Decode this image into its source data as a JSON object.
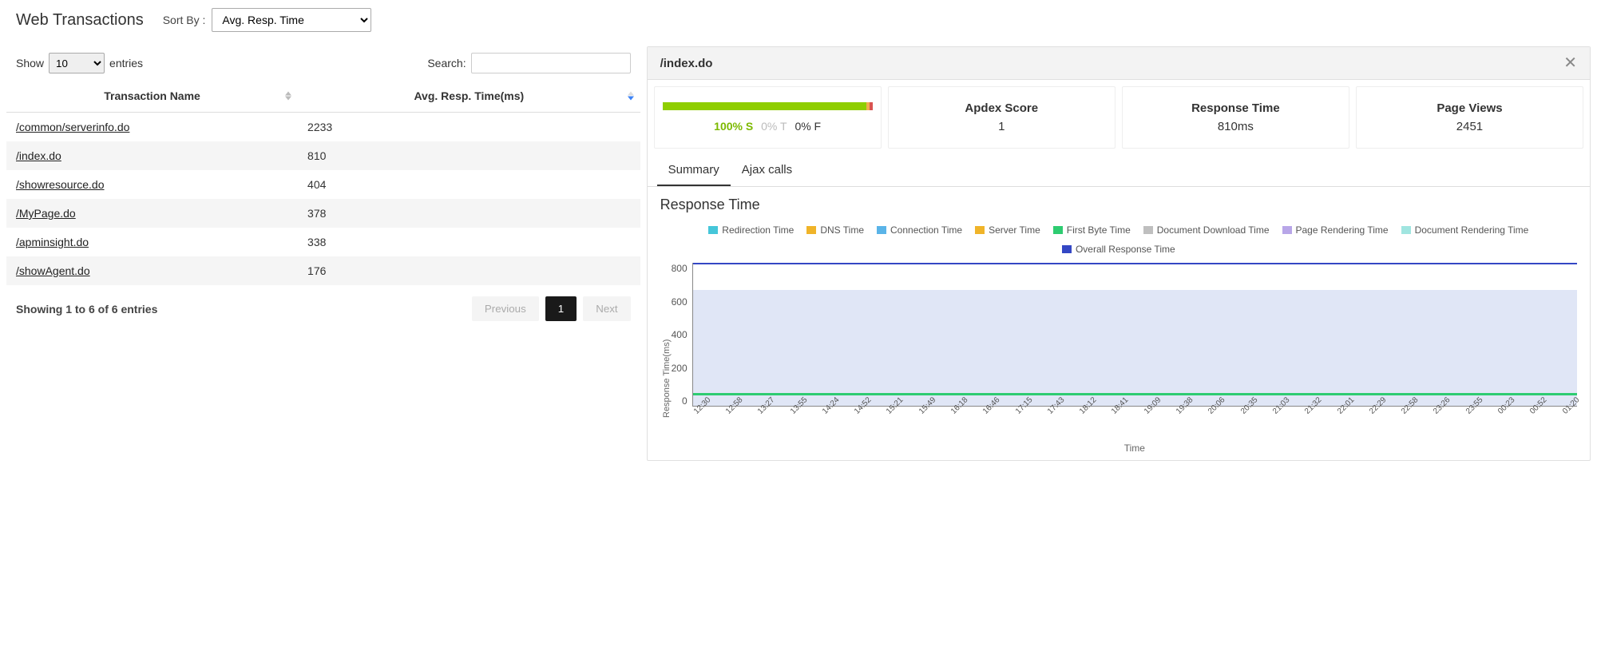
{
  "header": {
    "title": "Web Transactions",
    "sort_by_label": "Sort By :",
    "sort_by_value": "Avg. Resp. Time"
  },
  "table": {
    "show_label_pre": "Show",
    "show_value": "10",
    "show_label_post": "entries",
    "search_label": "Search:",
    "columns": {
      "name": "Transaction Name",
      "resp": "Avg. Resp. Time(ms)"
    },
    "rows": [
      {
        "name": "/common/serverinfo.do",
        "resp": "2233"
      },
      {
        "name": "/index.do",
        "resp": "810"
      },
      {
        "name": "/showresource.do",
        "resp": "404"
      },
      {
        "name": "/MyPage.do",
        "resp": "378"
      },
      {
        "name": "/apminsight.do",
        "resp": "338"
      },
      {
        "name": "/showAgent.do",
        "resp": "176"
      }
    ],
    "footer_info": "Showing 1 to 6 of 6 entries",
    "prev": "Previous",
    "page": "1",
    "next": "Next"
  },
  "detail": {
    "title": "/index.do",
    "satisfaction": {
      "s": "100% S",
      "t": "0% T",
      "f": "0% F"
    },
    "stats": [
      {
        "label": "Apdex Score",
        "value": "1"
      },
      {
        "label": "Response Time",
        "value": "810ms"
      },
      {
        "label": "Page Views",
        "value": "2451"
      }
    ],
    "tabs": {
      "summary": "Summary",
      "ajax": "Ajax calls"
    },
    "chart": {
      "title": "Response Time",
      "legend": [
        {
          "label": "Redirection Time",
          "color": "#45c6d9"
        },
        {
          "label": "DNS Time",
          "color": "#f0b429"
        },
        {
          "label": "Connection Time",
          "color": "#5ab4e8"
        },
        {
          "label": "Server Time",
          "color": "#f0b429"
        },
        {
          "label": "First Byte Time",
          "color": "#2ecc71"
        },
        {
          "label": "Document Download Time",
          "color": "#bfbfbf"
        },
        {
          "label": "Page Rendering Time",
          "color": "#b8a6e8"
        },
        {
          "label": "Document Rendering Time",
          "color": "#a0e5e0"
        },
        {
          "label": "Overall Response Time",
          "color": "#3447c4"
        }
      ],
      "ylabel": "Response Time(ms)",
      "xlabel": "Time",
      "yticks": [
        "800",
        "600",
        "400",
        "200",
        "0"
      ],
      "xticks": [
        "12:30",
        "12:58",
        "13:27",
        "13:55",
        "14:24",
        "14:52",
        "15:21",
        "15:49",
        "16:18",
        "16:46",
        "17:15",
        "17:43",
        "18:12",
        "18:41",
        "19:09",
        "19:38",
        "20:06",
        "20:35",
        "21:03",
        "21:32",
        "22:01",
        "22:29",
        "22:58",
        "23:26",
        "23:55",
        "00:23",
        "00:52",
        "01:20"
      ]
    }
  },
  "chart_data": {
    "type": "area",
    "title": "Response Time",
    "xlabel": "Time",
    "ylabel": "Response Time(ms)",
    "ylim": [
      0,
      800
    ],
    "x": [
      "12:30",
      "12:58",
      "13:27",
      "13:55",
      "14:24",
      "14:52",
      "15:21",
      "15:49",
      "16:18",
      "16:46",
      "17:15",
      "17:43",
      "18:12",
      "18:41",
      "19:09",
      "19:38",
      "20:06",
      "20:35",
      "21:03",
      "21:32",
      "22:01",
      "22:29",
      "22:58",
      "23:26",
      "23:55",
      "00:23",
      "00:52",
      "01:20"
    ],
    "series": [
      {
        "name": "Overall Response Time",
        "values": [
          810,
          810,
          810,
          810,
          810,
          810,
          810,
          810,
          810,
          810,
          810,
          810,
          810,
          810,
          810,
          810,
          810,
          810,
          810,
          810,
          810,
          810,
          810,
          810,
          810,
          810,
          810,
          810
        ]
      },
      {
        "name": "Page Rendering Time",
        "values": [
          650,
          650,
          650,
          650,
          650,
          650,
          650,
          650,
          650,
          650,
          650,
          650,
          650,
          650,
          650,
          650,
          650,
          650,
          650,
          650,
          650,
          650,
          650,
          650,
          650,
          650,
          650,
          650
        ]
      },
      {
        "name": "First Byte Time",
        "values": [
          60,
          60,
          60,
          60,
          60,
          60,
          60,
          60,
          60,
          60,
          60,
          60,
          60,
          60,
          60,
          60,
          60,
          60,
          60,
          60,
          60,
          60,
          60,
          60,
          60,
          60,
          60,
          60
        ]
      },
      {
        "name": "Redirection Time",
        "values": [
          0,
          0,
          0,
          0,
          0,
          0,
          0,
          0,
          0,
          0,
          0,
          0,
          0,
          0,
          0,
          0,
          0,
          0,
          0,
          0,
          0,
          0,
          0,
          0,
          0,
          0,
          0,
          0
        ]
      },
      {
        "name": "DNS Time",
        "values": [
          0,
          0,
          0,
          0,
          0,
          0,
          0,
          0,
          0,
          0,
          0,
          0,
          0,
          0,
          0,
          0,
          0,
          0,
          0,
          0,
          0,
          0,
          0,
          0,
          0,
          0,
          0,
          0
        ]
      },
      {
        "name": "Connection Time",
        "values": [
          0,
          0,
          0,
          0,
          0,
          0,
          0,
          0,
          0,
          0,
          0,
          0,
          0,
          0,
          0,
          0,
          0,
          0,
          0,
          0,
          0,
          0,
          0,
          0,
          0,
          0,
          0,
          0
        ]
      },
      {
        "name": "Server Time",
        "values": [
          0,
          0,
          0,
          0,
          0,
          0,
          0,
          0,
          0,
          0,
          0,
          0,
          0,
          0,
          0,
          0,
          0,
          0,
          0,
          0,
          0,
          0,
          0,
          0,
          0,
          0,
          0,
          0
        ]
      },
      {
        "name": "Document Download Time",
        "values": [
          0,
          0,
          0,
          0,
          0,
          0,
          0,
          0,
          0,
          0,
          0,
          0,
          0,
          0,
          0,
          0,
          0,
          0,
          0,
          0,
          0,
          0,
          0,
          0,
          0,
          0,
          0,
          0
        ]
      },
      {
        "name": "Document Rendering Time",
        "values": [
          0,
          0,
          0,
          0,
          0,
          0,
          0,
          0,
          0,
          0,
          0,
          0,
          0,
          0,
          0,
          0,
          0,
          0,
          0,
          0,
          0,
          0,
          0,
          0,
          0,
          0,
          0,
          0
        ]
      }
    ]
  }
}
